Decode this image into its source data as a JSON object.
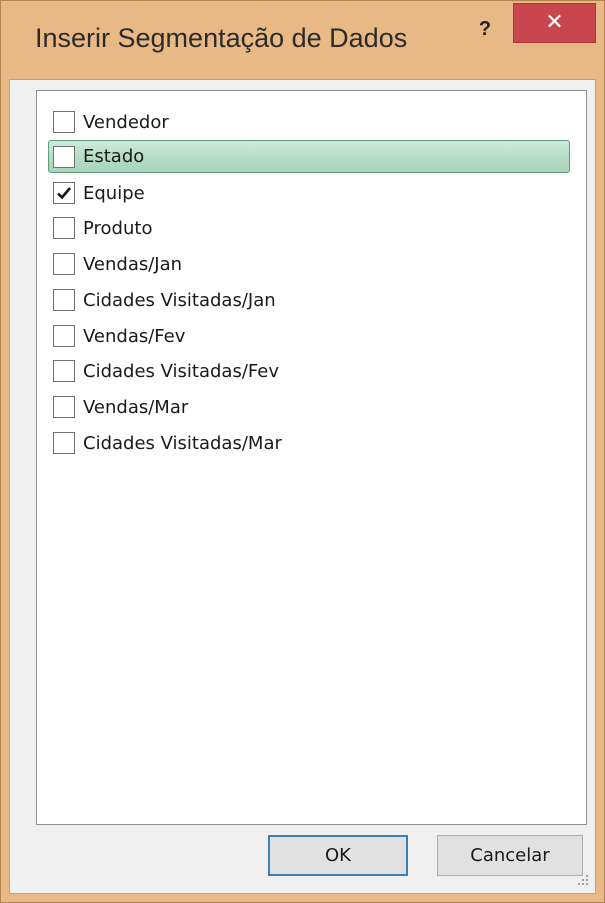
{
  "dialog": {
    "title": "Inserir Segmentação de Dados",
    "help_label": "?",
    "close_label": "✕"
  },
  "fields": [
    {
      "label": "Vendedor",
      "checked": false,
      "highlighted": false
    },
    {
      "label": "Estado",
      "checked": false,
      "highlighted": true
    },
    {
      "label": "Equipe",
      "checked": true,
      "highlighted": false
    },
    {
      "label": "Produto",
      "checked": false,
      "highlighted": false
    },
    {
      "label": "Vendas/Jan",
      "checked": false,
      "highlighted": false
    },
    {
      "label": "Cidades Visitadas/Jan",
      "checked": false,
      "highlighted": false
    },
    {
      "label": "Vendas/Fev",
      "checked": false,
      "highlighted": false
    },
    {
      "label": "Cidades Visitadas/Fev",
      "checked": false,
      "highlighted": false
    },
    {
      "label": "Vendas/Mar",
      "checked": false,
      "highlighted": false
    },
    {
      "label": "Cidades Visitadas/Mar",
      "checked": false,
      "highlighted": false
    }
  ],
  "buttons": {
    "ok_label": "OK",
    "cancel_label": "Cancelar"
  },
  "colors": {
    "title_bar": "#e9b985",
    "close_button": "#c8464d",
    "highlight": "#b7ddc8",
    "ok_border": "#3c7fb1"
  }
}
